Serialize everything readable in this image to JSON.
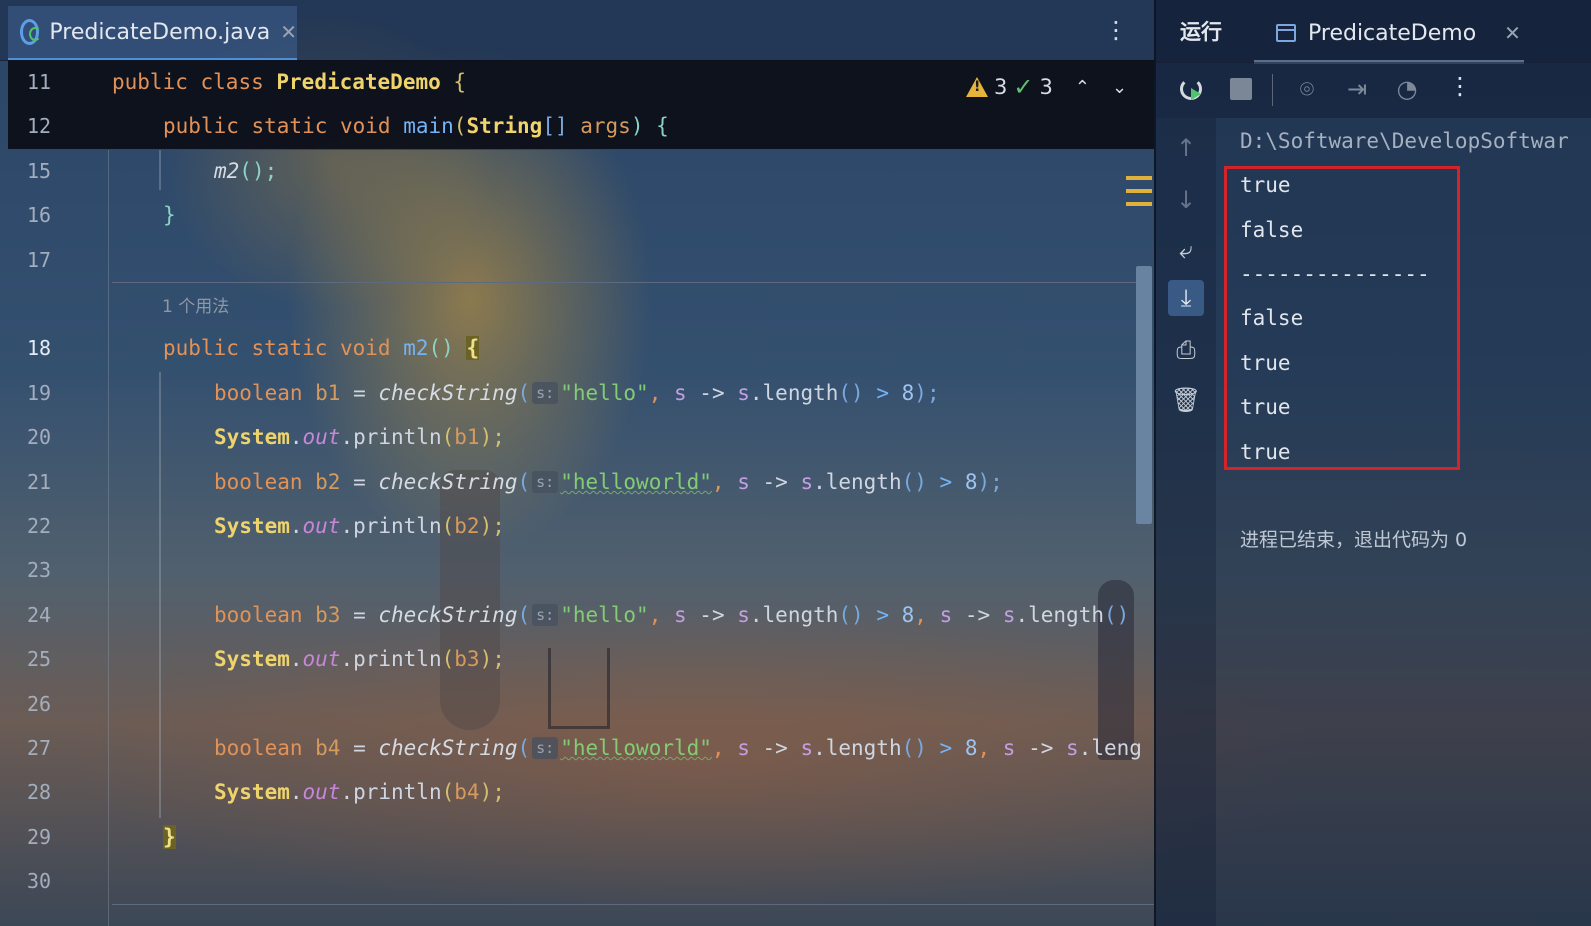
{
  "editor": {
    "tab": {
      "title": "PredicateDemo.java",
      "close": "✕"
    },
    "more_icon": "⋮",
    "inspections": {
      "warnings": "3",
      "checks": "3",
      "up": "⌃",
      "down": "⌄"
    },
    "usages_hint": "1 个用法"
  },
  "lines": [
    {
      "n": "11"
    },
    {
      "n": "12"
    },
    {
      "n": "15"
    },
    {
      "n": "16"
    },
    {
      "n": "17"
    },
    {
      "n": "18"
    },
    {
      "n": "19"
    },
    {
      "n": "20"
    },
    {
      "n": "21"
    },
    {
      "n": "22"
    },
    {
      "n": "23"
    },
    {
      "n": "24"
    },
    {
      "n": "25"
    },
    {
      "n": "26"
    },
    {
      "n": "27"
    },
    {
      "n": "28"
    },
    {
      "n": "29"
    },
    {
      "n": "30"
    }
  ],
  "code": {
    "l11": {
      "kw1": "public",
      "kw2": "class",
      "cls": "PredicateDemo",
      "tail": " {"
    },
    "l12": {
      "kw": "public static void ",
      "fn": "main",
      "p1": "(",
      "type": "String",
      "arr": "[] ",
      "arg": "args",
      "p2": ") {"
    },
    "l15": {
      "call": "m2",
      "tail": "();"
    },
    "l16": {
      "brace": "}"
    },
    "l18": {
      "kw": "public static void ",
      "fn": "m2",
      "p": "() ",
      "brace": "{"
    },
    "l19": {
      "decl": "boolean ",
      "var": "b1",
      "eq": " = ",
      "fn": "checkString",
      "open": "(",
      "hint": "s:",
      "str": "\"hello\"",
      "c1": ", ",
      "lam": "s",
      "arrow": " -> ",
      "obj": "s",
      "dot": ".length",
      "call": "()",
      "op": " > ",
      "num": "8",
      "end": ");"
    },
    "l20": {
      "sys": "System",
      "dot": ".",
      "out": "out",
      "pr": ".println",
      "open": "(",
      "var": "b1",
      "end": ");"
    },
    "l21": {
      "decl": "boolean ",
      "var": "b2",
      "eq": " = ",
      "fn": "checkString",
      "open": "(",
      "hint": "s:",
      "str": "\"helloworld\"",
      "c1": ", ",
      "lam": "s",
      "arrow": " -> ",
      "obj": "s",
      "dot": ".length",
      "call": "()",
      "op": " > ",
      "num": "8",
      "end": ");"
    },
    "l22": {
      "sys": "System",
      "dot": ".",
      "out": "out",
      "pr": ".println",
      "open": "(",
      "var": "b2",
      "end": ");"
    },
    "l24": {
      "decl": "boolean ",
      "var": "b3",
      "eq": " = ",
      "fn": "checkString",
      "open": "(",
      "hint": "s:",
      "str": "\"hello\"",
      "c1": ", ",
      "lam": "s",
      "arrow": " -> ",
      "obj": "s",
      "dot": ".length",
      "call": "()",
      "op": " > ",
      "num": "8",
      "c2": ", ",
      "lam2": "s",
      "arrow2": " -> ",
      "obj2": "s",
      "dot2": ".length",
      "call2": "()"
    },
    "l25": {
      "sys": "System",
      "dot": ".",
      "out": "out",
      "pr": ".println",
      "open": "(",
      "var": "b3",
      "end": ");"
    },
    "l27": {
      "decl": "boolean ",
      "var": "b4",
      "eq": " = ",
      "fn": "checkString",
      "open": "(",
      "hint": "s:",
      "str": "\"helloworld\"",
      "c1": ", ",
      "lam": "s",
      "arrow": " -> ",
      "obj": "s",
      "dot": ".length",
      "call": "()",
      "op": " > ",
      "num": "8",
      "c2": ", ",
      "lam2": "s",
      "arrow2": " -> ",
      "obj2": "s",
      "dot2": ".leng"
    },
    "l28": {
      "sys": "System",
      "dot": ".",
      "out": "out",
      "pr": ".println",
      "open": "(",
      "var": "b4",
      "end": ");"
    },
    "l29": {
      "brace": "}"
    }
  },
  "run": {
    "label": "运行",
    "tab_title": "PredicateDemo",
    "tab_close": "✕",
    "more_icon": "⋮",
    "console": {
      "path": "D:\\Software\\DevelopSoftwar",
      "outputs": [
        "true",
        "false",
        "---------------",
        "false",
        "true",
        "true",
        "true"
      ],
      "exit_message": "进程已结束，退出代码为 0"
    }
  },
  "colors": {
    "highlight_box": "#d4232b",
    "accent": "#4e8fd8"
  }
}
